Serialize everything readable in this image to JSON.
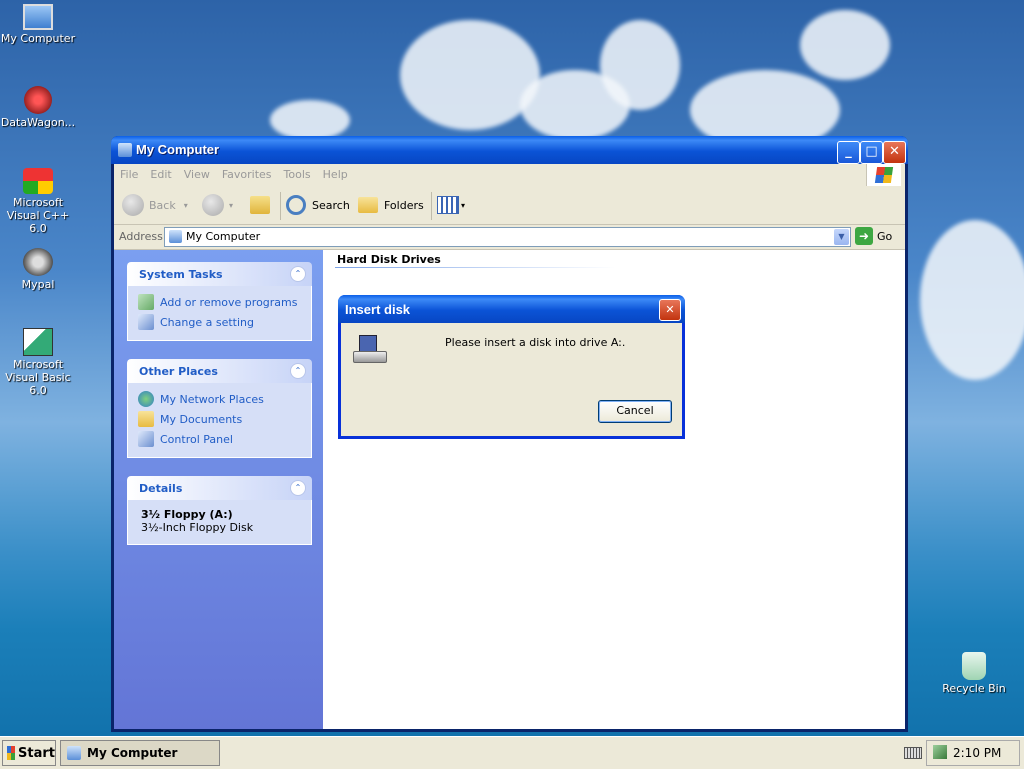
{
  "desktop": {
    "icons": [
      {
        "label": "My Computer"
      },
      {
        "label": "DataWagon..."
      },
      {
        "label": "Microsoft Visual C++ 6.0"
      },
      {
        "label": "Mypal"
      },
      {
        "label": "Microsoft Visual Basic 6.0"
      },
      {
        "label": "Recycle Bin"
      }
    ]
  },
  "window": {
    "title": "My Computer",
    "menu": [
      "File",
      "Edit",
      "View",
      "Favorites",
      "Tools",
      "Help"
    ],
    "toolbar": {
      "back": "Back",
      "search": "Search",
      "folders": "Folders"
    },
    "address": {
      "label": "Address",
      "value": "My Computer",
      "go": "Go"
    },
    "taskpane": {
      "system_tasks": {
        "title": "System Tasks",
        "items": [
          "Add or remove programs",
          "Change a setting"
        ]
      },
      "other_places": {
        "title": "Other Places",
        "items": [
          "My Network Places",
          "My Documents",
          "Control Panel"
        ]
      },
      "details": {
        "title": "Details",
        "name": "3½ Floppy (A:)",
        "type": "3½-Inch Floppy Disk"
      }
    },
    "content": {
      "section": "Hard Disk Drives"
    }
  },
  "dialog": {
    "title": "Insert disk",
    "message": "Please insert a disk into drive A:.",
    "cancel": "Cancel"
  },
  "taskbar": {
    "start": "Start",
    "task": "My Computer",
    "clock": "2:10 PM"
  }
}
